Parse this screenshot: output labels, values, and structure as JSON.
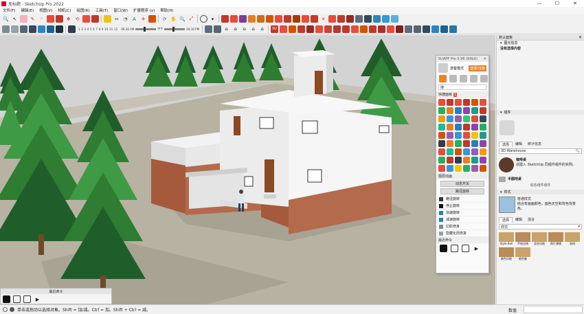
{
  "window": {
    "title": "无标题 - SketchUp Pro 2022",
    "controls": [
      "—",
      "☐",
      "✕"
    ]
  },
  "menubar": [
    "文件(F)",
    "编辑(E)",
    "视图(V)",
    "相机(C)",
    "绘图(R)",
    "工具(T)",
    "窗口(W)",
    "扩展程序 (x)",
    "帮助(H)"
  ],
  "shadow_settings": {
    "months": "1 2 3 4 5 6 7 8 9 10 11 12",
    "time_start": "06:30 AM",
    "time_mid": "中午",
    "time_end": "04:30 PM"
  },
  "suapp": {
    "header": "SUAPP Pro 3.96 (64bit)",
    "user_label": "游客模式",
    "login_btn": "登录/注册",
    "search_placeholder": "搜",
    "shortcut_label": "快捷面板",
    "shortcut_badge": "1",
    "section_anim": "图层动画",
    "anim_toggle1": "动态开关",
    "anim_toggle2": "路径旋转",
    "items": [
      "路径旋转",
      "停止旋转",
      "加速旋转",
      "减速旋转",
      "幻影修身",
      "隐藏化而恢复"
    ],
    "section_recent": "最近命令"
  },
  "bottom_tray": {
    "title": "最近命令"
  },
  "right_panel": {
    "default_panel": "默认面板",
    "entity_info": "图元信息",
    "no_selection": "没有选择内容",
    "components_header": "组件",
    "comp_tabs": [
      "选择",
      "编辑",
      "统计信息"
    ],
    "comp_search": "3D Warehouse",
    "comp_items": [
      {
        "name": "咖啡桌",
        "desc": "创建入 SketchUp 同组件组件的实例。"
      },
      {
        "name": "半圆吧桌",
        "desc": ""
      }
    ],
    "comp_footer": "动态组件组件",
    "styles_header": "样式",
    "style_name": "普通样式",
    "style_desc": "结合有画面颜色，面色天空和背色背景色。",
    "style_tabs": [
      "选择",
      "编辑",
      "混合"
    ],
    "style_dropdown": "样式",
    "style_items": [
      "Style Bull",
      "手绘边线",
      "混合风格",
      "照片建模",
      "直线",
      "颜色风格",
      "颜色集"
    ]
  },
  "statusbar": {
    "text": "单击或拖动以选择对象。Shift = 加/减。Ctrl = 加。Shift + Ctrl = 减。",
    "measure_label": "数值"
  },
  "colors": {
    "sky": "#d4d4d4",
    "ground": "#b9b3a4",
    "tree_dark": "#1f5e2a",
    "tree_light": "#3f9a46",
    "brick": "#a55a3c",
    "wall": "#e8e8e8",
    "suapp_accent": "#e8842a"
  }
}
